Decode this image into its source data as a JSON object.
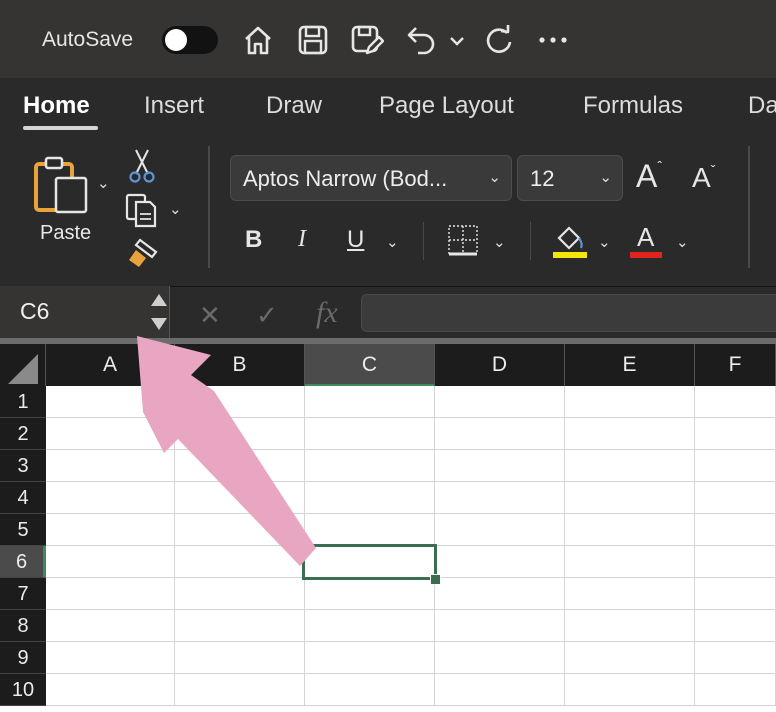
{
  "titlebar": {
    "autosave_label": "AutoSave",
    "autosave_on": false,
    "icons": [
      "home-icon",
      "save-icon",
      "save-as-edit-icon",
      "undo-icon",
      "chevron-down-icon",
      "redo-icon",
      "more-icon"
    ]
  },
  "ribbon": {
    "tabs": [
      {
        "label": "Home",
        "active": true
      },
      {
        "label": "Insert"
      },
      {
        "label": "Draw"
      },
      {
        "label": "Page Layout"
      },
      {
        "label": "Formulas"
      },
      {
        "label": "Da"
      }
    ],
    "paste_label": "Paste",
    "font_name": "Aptos Narrow (Bod...",
    "font_size": "12",
    "bold_label": "B",
    "italic_label": "I",
    "underline_label": "U",
    "increase_font_label": "A",
    "decrease_font_label": "A",
    "font_color_label": "A",
    "highlight_color": "#f5e50a",
    "font_color": "#e0231b"
  },
  "formula_bar": {
    "name_box": "C6",
    "cancel_symbol": "✕",
    "confirm_symbol": "✓",
    "fx_label": "fx",
    "formula_value": ""
  },
  "grid": {
    "columns": [
      "A",
      "B",
      "C",
      "D",
      "E",
      "F"
    ],
    "rows": [
      "1",
      "2",
      "3",
      "4",
      "5",
      "6",
      "7",
      "8",
      "9",
      "10"
    ],
    "selected_cell": "C6",
    "accent": "#3b6e4f"
  },
  "annotation": {
    "arrow_color": "#e8a6c3"
  }
}
